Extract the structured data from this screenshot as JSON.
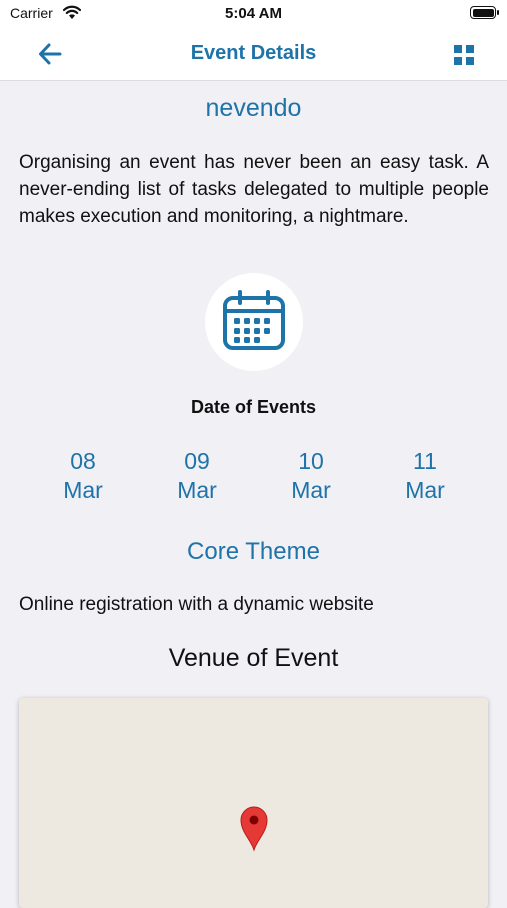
{
  "status_bar": {
    "carrier": "Carrier",
    "time": "5:04 AM"
  },
  "nav": {
    "title": "Event Details",
    "back_icon": "back-arrow-icon",
    "menu_icon": "grid-icon"
  },
  "org_name": "nevendo",
  "description": "Organising an event has never been an easy task. A never-ending list of tasks delegated to multiple people makes execution and monitoring, a nightmare.",
  "date_section": {
    "heading": "Date of Events",
    "icon": "calendar-icon",
    "dates": [
      {
        "day": "08",
        "month": "Mar"
      },
      {
        "day": "09",
        "month": "Mar"
      },
      {
        "day": "10",
        "month": "Mar"
      },
      {
        "day": "11",
        "month": "Mar"
      }
    ]
  },
  "theme": {
    "heading": "Core Theme",
    "text": "Online registration with a dynamic website"
  },
  "venue": {
    "heading": "Venue of Event",
    "pin_icon": "map-pin-icon"
  },
  "colors": {
    "accent": "#1e73a8",
    "background": "#f0f0f5",
    "map": "#ede9e1",
    "pin": "#e53935"
  }
}
